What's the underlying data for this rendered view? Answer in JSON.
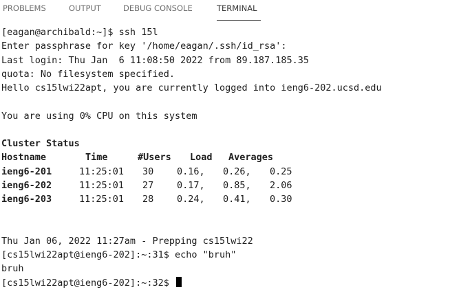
{
  "panel": {
    "tabs": [
      {
        "label": "PROBLEMS",
        "active": false
      },
      {
        "label": "OUTPUT",
        "active": false
      },
      {
        "label": "DEBUG CONSOLE",
        "active": false
      },
      {
        "label": "TERMINAL",
        "active": true
      }
    ]
  },
  "terminal": {
    "lines_top": [
      "[eagan@archibald:~]$ ssh 15l",
      "Enter passphrase for key '/home/eagan/.ssh/id_rsa':",
      "Last login: Thu Jan  6 11:08:50 2022 from 89.187.185.35",
      "quota: No filesystem specified.",
      "Hello cs15lwi22apt, you are currently logged into ieng6-202.ucsd.edu",
      "",
      "You are using 0% CPU on this system",
      ""
    ],
    "cluster_status": {
      "title": "Cluster Status",
      "headers": {
        "hostname": "Hostname",
        "time": "Time",
        "users": "#Users",
        "load": "Load",
        "averages": "Averages"
      },
      "rows": [
        {
          "host": "ieng6-201",
          "time": "11:25:01",
          "users": "30",
          "l1": "0.16,",
          "l2": "0.26,",
          "l3": "0.25"
        },
        {
          "host": "ieng6-202",
          "time": "11:25:01",
          "users": "27",
          "l1": "0.17,",
          "l2": "0.85,",
          "l3": "2.06"
        },
        {
          "host": "ieng6-203",
          "time": "11:25:01",
          "users": "28",
          "l1": "0.24,",
          "l2": "0.41,",
          "l3": "0.30"
        }
      ]
    },
    "lines_bottom": [
      "",
      "",
      "Thu Jan 06, 2022 11:27am - Prepping cs15lwi22",
      "[cs15lwi22apt@ieng6-202]:~:31$ echo \"bruh\"",
      "bruh"
    ],
    "prompt": "[cs15lwi22apt@ieng6-202]:~:32$ "
  }
}
